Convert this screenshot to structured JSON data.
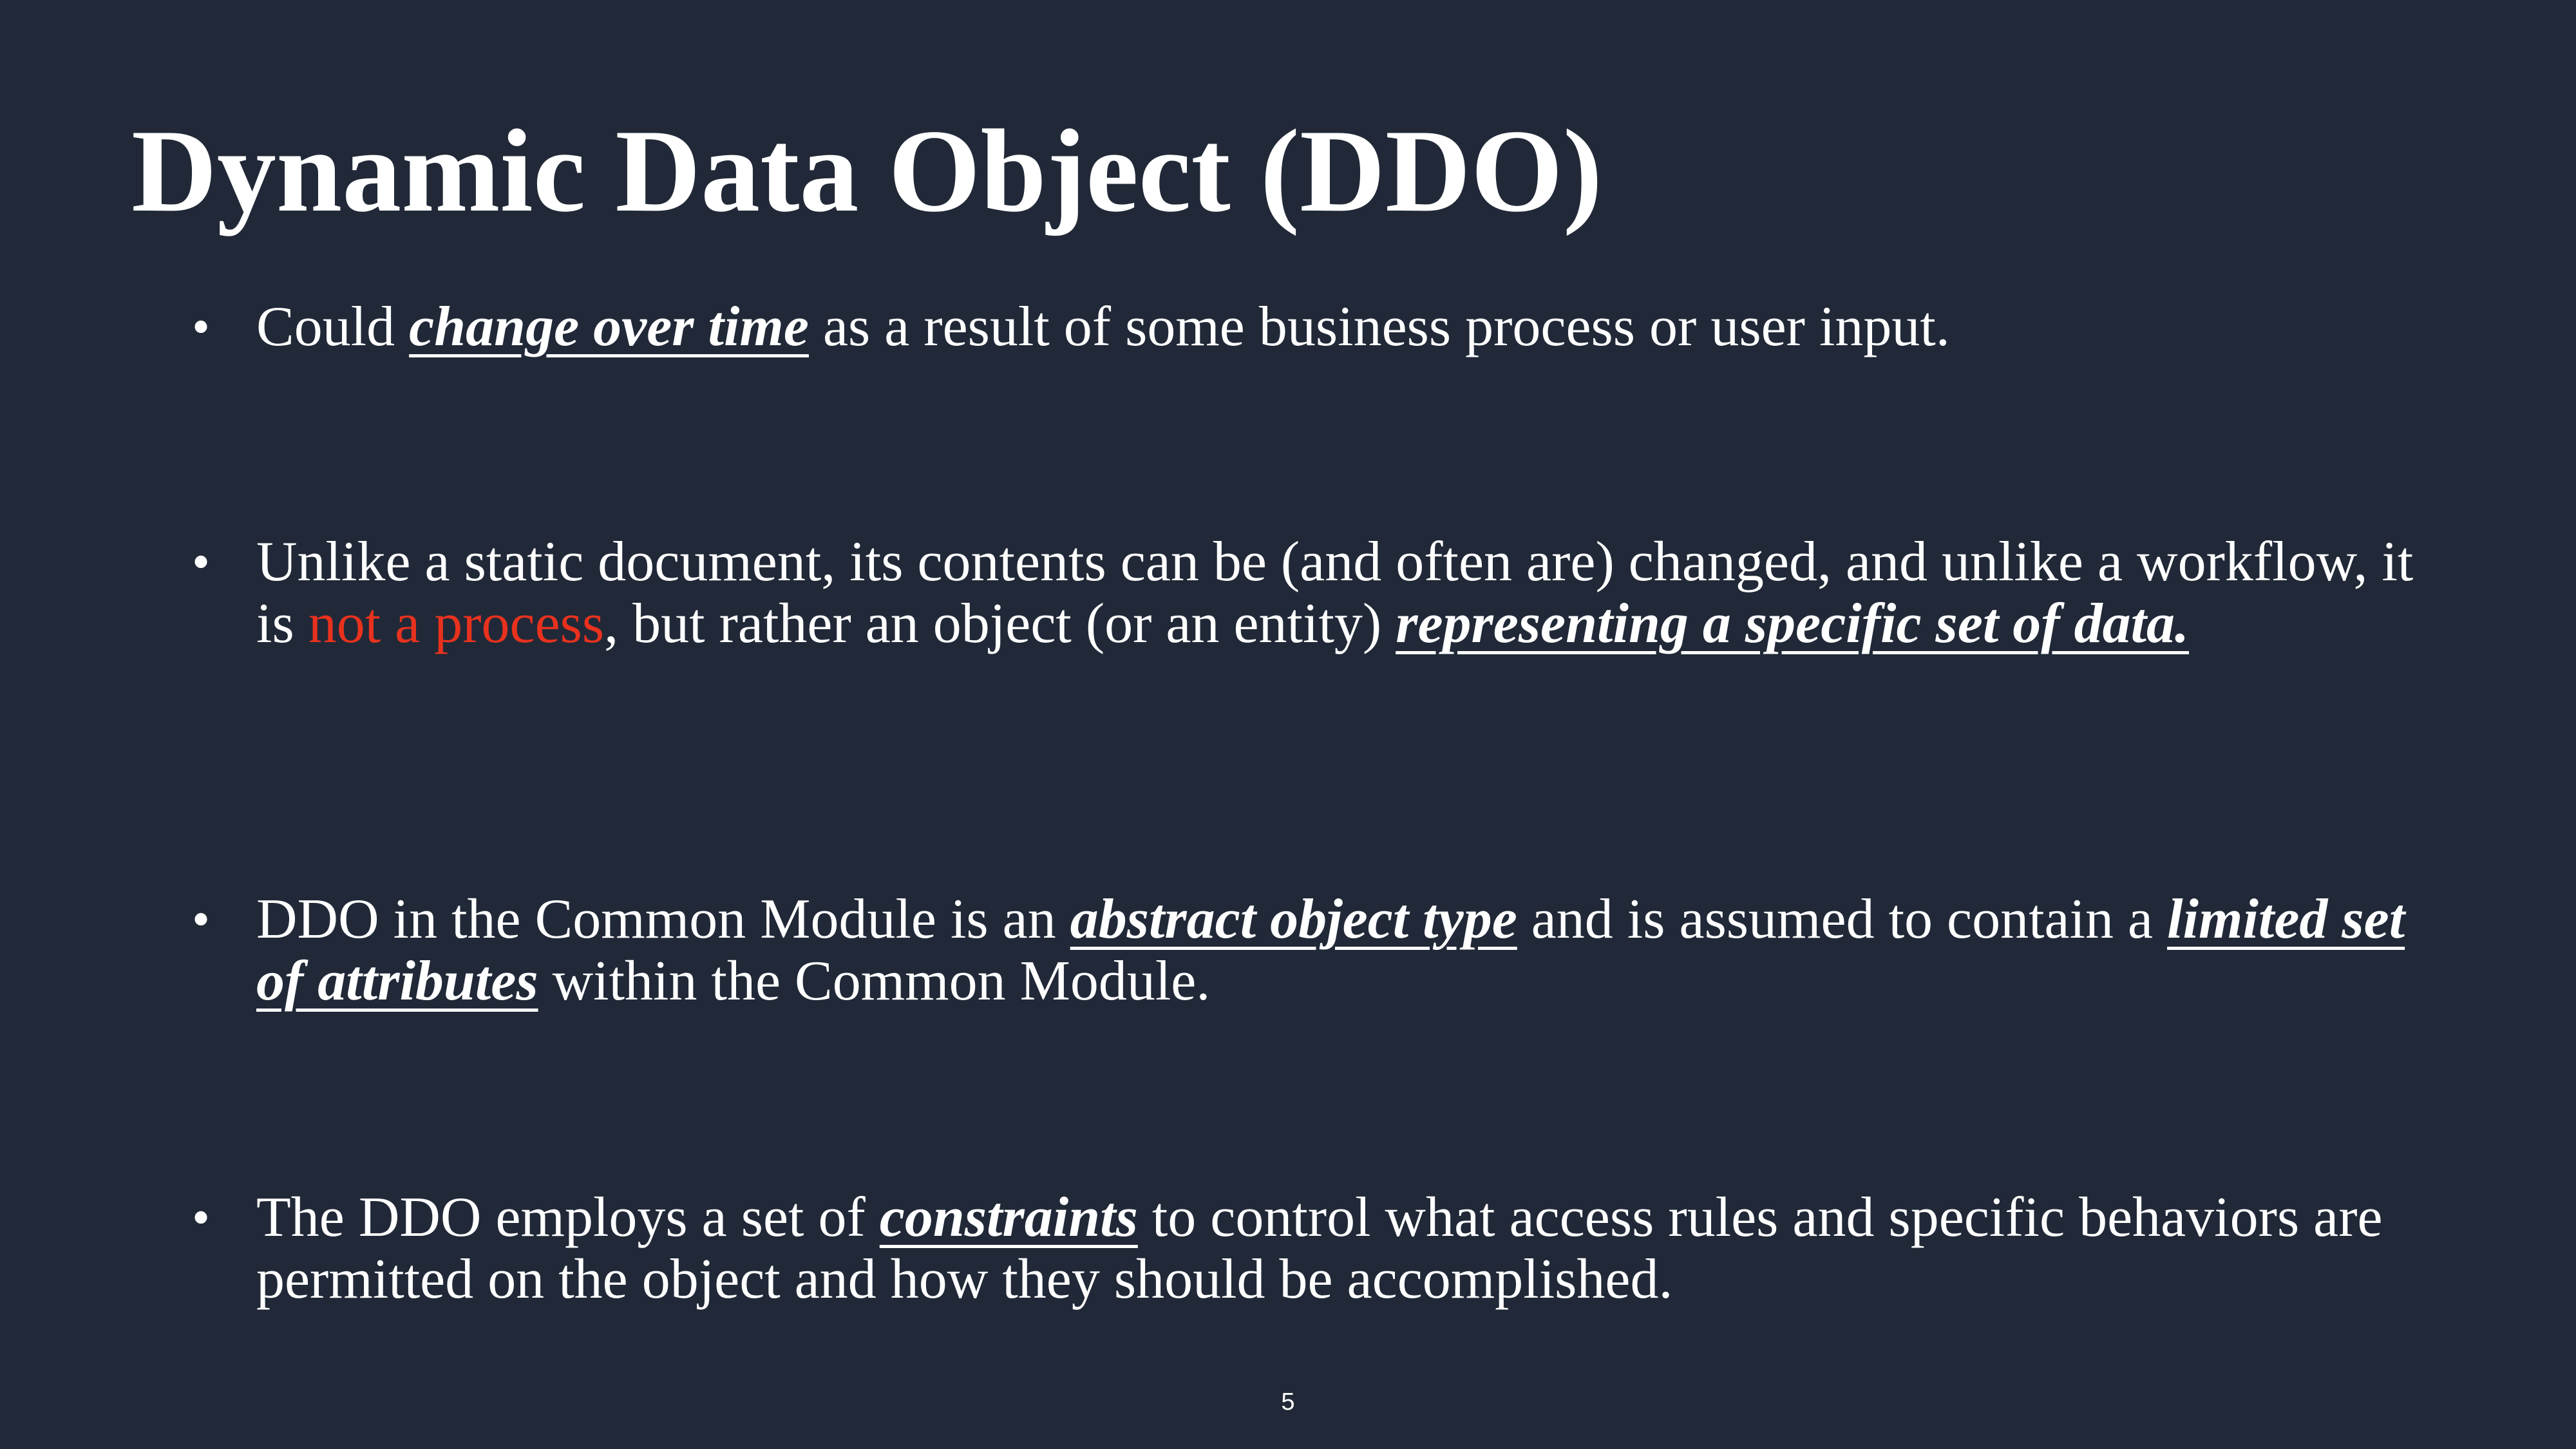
{
  "slide": {
    "title": "Dynamic Data Object (DDO)",
    "bullet_symbol": "•",
    "page_number": "5",
    "accent_color": "#e8321e",
    "background_color": "#212938",
    "bullets": [
      {
        "parts": [
          "Could ",
          "change over time",
          " as a result of some business process or user input."
        ]
      },
      {
        "parts": [
          "Unlike a static document, its contents can be (and often are) changed, and unlike a workflow, it is ",
          "not a process",
          ", but rather an object (or an entity) ",
          "representing a specific set of data."
        ]
      },
      {
        "parts": [
          "DDO in the Common Module is an ",
          "abstract object type",
          " and is assumed to contain a ",
          "limited set of attributes",
          " within the Common Module."
        ]
      },
      {
        "parts": [
          "The DDO employs a set of ",
          "constraints",
          " to control what access rules and specific behaviors are permitted on the object and how they should be accomplished."
        ]
      }
    ]
  }
}
